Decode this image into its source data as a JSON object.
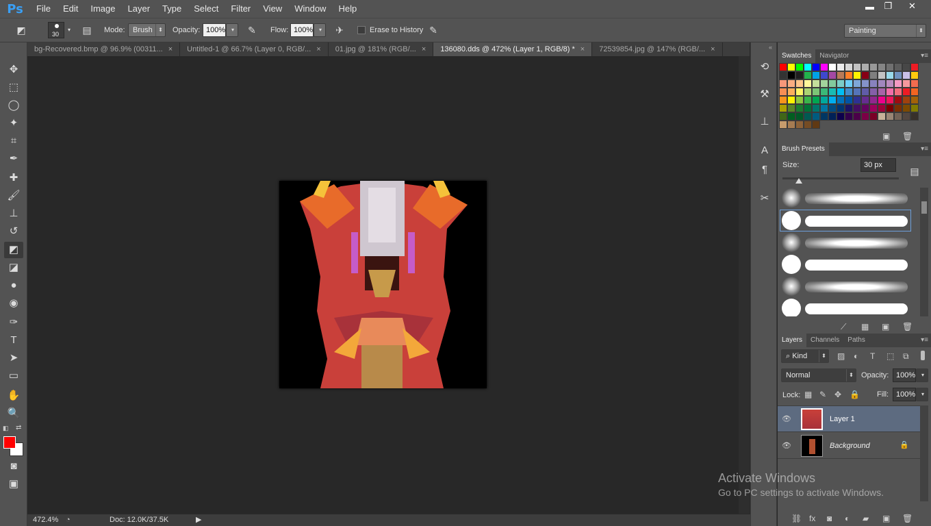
{
  "app": {
    "logo": "Ps"
  },
  "menu": [
    "File",
    "Edit",
    "Image",
    "Layer",
    "Type",
    "Select",
    "Filter",
    "View",
    "Window",
    "Help"
  ],
  "window_buttons": {
    "minimize": "▬",
    "restore": "❐",
    "close": "✕"
  },
  "options": {
    "brush_size": "30",
    "mode_label": "Mode:",
    "mode_value": "Brush",
    "opacity_label": "Opacity:",
    "opacity_value": "100%",
    "flow_label": "Flow:",
    "flow_value": "100%",
    "erase_history_label": "Erase to History",
    "workspace": "Painting"
  },
  "tabs": [
    {
      "label": "bg-Recovered.bmp @ 96.9% (00311...",
      "close": "×"
    },
    {
      "label": "Untitled-1 @ 66.7% (Layer 0, RGB/...",
      "close": "×"
    },
    {
      "label": "01.jpg @ 181% (RGB/...",
      "close": "×"
    },
    {
      "label": "136080.dds @ 472% (Layer 1, RGB/8) *",
      "close": "×"
    },
    {
      "label": "72539854.jpg @ 147% (RGB/...",
      "close": "×"
    }
  ],
  "status": {
    "zoom": "472.4%",
    "doc": "Doc: 12.0K/37.5K"
  },
  "swatches_panel": {
    "tab_swatches": "Swatches",
    "tab_navigator": "Navigator"
  },
  "brush_presets": {
    "title": "Brush Presets",
    "size_label": "Size:",
    "size_value": "30 px"
  },
  "layers_panel": {
    "tabs": [
      "Layers",
      "Channels",
      "Paths"
    ],
    "kind_label": "Kind",
    "blend_mode": "Normal",
    "opacity_label": "Opacity:",
    "opacity_value": "100%",
    "lock_label": "Lock:",
    "fill_label": "Fill:",
    "fill_value": "100%",
    "layers": [
      {
        "name": "Layer 1"
      },
      {
        "name": "Background"
      }
    ]
  },
  "watermark": {
    "line1": "Activate Windows",
    "line2": "Go to PC settings to activate Windows."
  },
  "colors": {
    "foreground": "#ff0000",
    "background": "#ffffff",
    "accent": "#3a9ff4"
  }
}
